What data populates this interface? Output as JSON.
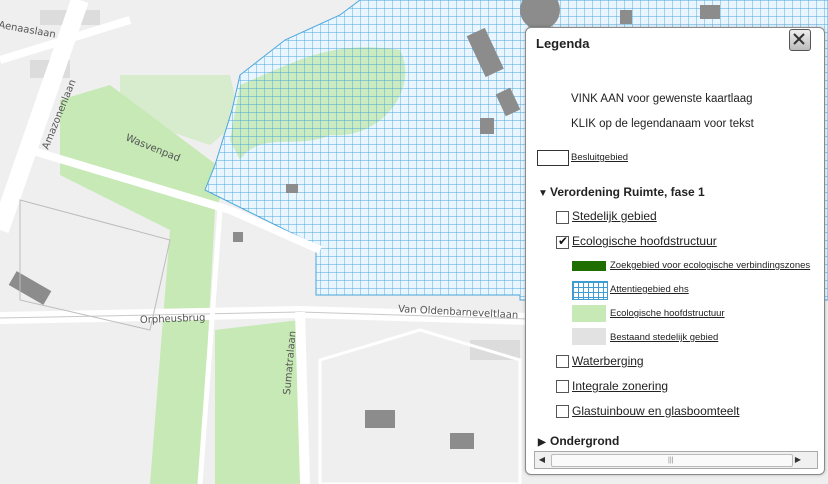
{
  "map": {
    "streets": [
      "Aenaaslaan",
      "Amazonenlaan",
      "Wasvenpad",
      "Orpheusbrug",
      "Van Oldenbarneveltlaan",
      "Sumatralaan"
    ]
  },
  "legend": {
    "title": "Legenda",
    "close_icon": "close-icon",
    "instructions": [
      "VINK AAN voor gewenste kaartlaag",
      "KLIK op de legendanaam voor tekst"
    ],
    "besluitgebied": "Besluitgebied",
    "group_verordening": {
      "label": "Verordening Ruimte, fase 1",
      "expanded": true
    },
    "layers": [
      {
        "label": "Stedelijk gebied",
        "checked": false
      },
      {
        "label": "Ecologische hoofdstructuur",
        "checked": true
      }
    ],
    "sublegend": [
      {
        "label": "Zoekgebied voor ecologische verbindingszones",
        "color": "#1e6e00"
      },
      {
        "label": "Attentiegebied ehs",
        "color": "#3f9bd3"
      },
      {
        "label": "Ecologische hoofdstructuur",
        "color": "#c6e9b5"
      },
      {
        "label": "Bestaand stedelijk gebied",
        "color": "#e2e2e2"
      }
    ],
    "layers_more": [
      {
        "label": "Waterberging",
        "checked": false
      },
      {
        "label": "Integrale zonering",
        "checked": false
      },
      {
        "label": "Glastuinbouw en glasboomteelt",
        "checked": false
      }
    ],
    "group_ondergrond": {
      "label": "Ondergrond",
      "expanded": false
    },
    "scrollbar": {
      "left_arrow": "◀",
      "right_arrow": "▶",
      "grip": "|||"
    }
  }
}
